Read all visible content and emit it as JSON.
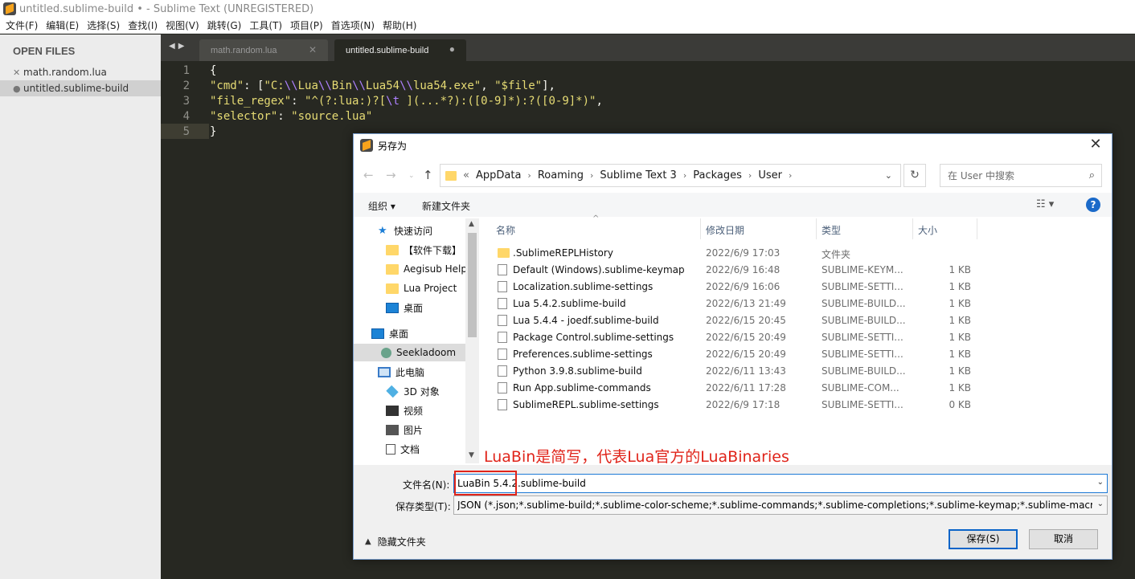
{
  "window": {
    "title": "untitled.sublime-build • - Sublime Text (UNREGISTERED)"
  },
  "menubar": [
    "文件(F)",
    "编辑(E)",
    "选择(S)",
    "查找(I)",
    "视图(V)",
    "跳转(G)",
    "工具(T)",
    "项目(P)",
    "首选项(N)",
    "帮助(H)"
  ],
  "sidebar": {
    "header": "OPEN FILES",
    "files": [
      {
        "mark": "✕",
        "name": "math.random.lua",
        "active": false
      },
      {
        "mark": "●",
        "name": "untitled.sublime-build",
        "active": true
      }
    ]
  },
  "tabs": [
    {
      "label": "math.random.lua",
      "close": "✕"
    },
    {
      "label": "untitled.sublime-build",
      "close": "●"
    }
  ],
  "editor": {
    "line_numbers": [
      "1",
      "2",
      "3",
      "4",
      "5"
    ],
    "lines": [
      "{",
      "\"cmd\": [\"C:\\\\Lua\\\\Bin\\\\Lua54\\\\lua54.exe\", \"$file\"],",
      "\"file_regex\": \"^(?:lua:)?[\\t ](...*?):([0-9]*):?([0-9]*)\",",
      "\"selector\": \"source.lua\"",
      "}"
    ],
    "current_line": 5
  },
  "dialog": {
    "title": "另存为",
    "close_glyph": "✕",
    "address": {
      "prefix": "«",
      "crumbs": [
        "AppData",
        "Roaming",
        "Sublime Text 3",
        "Packages",
        "User"
      ],
      "separator": "›"
    },
    "search_placeholder": "在 User 中搜索",
    "commands": {
      "organize": "组织 ▾",
      "new_folder": "新建文件夹"
    },
    "nav": [
      {
        "label": "快速访问",
        "icon": "star-icon",
        "indent": 1
      },
      {
        "label": "【软件下载】",
        "icon": "folder-icon",
        "indent": 2
      },
      {
        "label": "Aegisub Helpe",
        "icon": "folder-icon",
        "indent": 2
      },
      {
        "label": "Lua Project",
        "icon": "folder-icon",
        "indent": 2
      },
      {
        "label": "桌面",
        "icon": "desktop-icon",
        "indent": 2
      },
      {
        "label": "桌面",
        "icon": "desktop-icon",
        "indent": 0
      },
      {
        "label": "Seekladoom",
        "icon": "user-icon",
        "indent": 1
      },
      {
        "label": "此电脑",
        "icon": "pc-icon",
        "indent": 1
      },
      {
        "label": "3D 对象",
        "icon": "3d-objects-icon",
        "indent": 2
      },
      {
        "label": "视频",
        "icon": "video-icon",
        "indent": 2
      },
      {
        "label": "图片",
        "icon": "pictures-icon",
        "indent": 2
      },
      {
        "label": "文档",
        "icon": "documents-icon",
        "indent": 2
      }
    ],
    "columns": {
      "name": "名称",
      "date": "修改日期",
      "type": "类型",
      "size": "大小"
    },
    "files": [
      {
        "name": ".SublimeREPLHistory",
        "date": "2022/6/9 17:03",
        "type": "文件夹",
        "size": "",
        "folder": true
      },
      {
        "name": "Default (Windows).sublime-keymap",
        "date": "2022/6/9 16:48",
        "type": "SUBLIME-KEYM...",
        "size": "1 KB"
      },
      {
        "name": "Localization.sublime-settings",
        "date": "2022/6/9 16:06",
        "type": "SUBLIME-SETTI...",
        "size": "1 KB"
      },
      {
        "name": "Lua 5.4.2.sublime-build",
        "date": "2022/6/13 21:49",
        "type": "SUBLIME-BUILD...",
        "size": "1 KB"
      },
      {
        "name": "Lua 5.4.4 - joedf.sublime-build",
        "date": "2022/6/15 20:45",
        "type": "SUBLIME-BUILD...",
        "size": "1 KB"
      },
      {
        "name": "Package Control.sublime-settings",
        "date": "2022/6/15 20:49",
        "type": "SUBLIME-SETTI...",
        "size": "1 KB"
      },
      {
        "name": "Preferences.sublime-settings",
        "date": "2022/6/15 20:49",
        "type": "SUBLIME-SETTI...",
        "size": "1 KB"
      },
      {
        "name": "Python 3.9.8.sublime-build",
        "date": "2022/6/11 13:43",
        "type": "SUBLIME-BUILD...",
        "size": "1 KB"
      },
      {
        "name": "Run App.sublime-commands",
        "date": "2022/6/11 17:28",
        "type": "SUBLIME-COM...",
        "size": "1 KB"
      },
      {
        "name": "SublimeREPL.sublime-settings",
        "date": "2022/6/9 17:18",
        "type": "SUBLIME-SETTI...",
        "size": "0 KB"
      }
    ],
    "annotation": "LuaBin是简写，代表Lua官方的LuaBinaries",
    "filename_label": "文件名(N):",
    "filename_value": "LuaBin 5.4.2.sublime-build",
    "filetype_label": "保存类型(T):",
    "filetype_value": "JSON (*.json;*.sublime-build;*.sublime-color-scheme;*.sublime-commands;*.sublime-completions;*.sublime-keymap;*.sublime-macro;*.sublime-menu)",
    "hide_folders": "隐藏文件夹",
    "save_button": "保存(S)",
    "cancel_button": "取消"
  },
  "colors": {
    "editor_bg": "#272822",
    "string": "#e6db74",
    "escape": "#ae81ff",
    "annotation": "#e0241a",
    "dialog_accent": "#1e7ad6"
  }
}
